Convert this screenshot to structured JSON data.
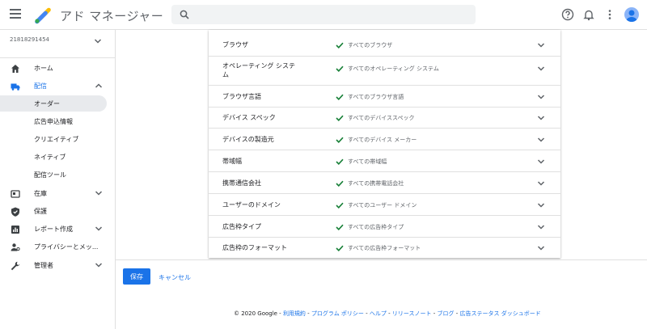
{
  "header": {
    "app_title": "アド マネージャー",
    "search_placeholder": ""
  },
  "sidebar": {
    "account": "21818291454",
    "items": [
      {
        "label": "ホーム",
        "icon": "home-icon"
      },
      {
        "label": "配信",
        "icon": "truck-icon",
        "active": true,
        "expanded": true
      },
      {
        "label": "在庫",
        "icon": "inventory-icon"
      },
      {
        "label": "保護",
        "icon": "shield-icon"
      },
      {
        "label": "レポート作成",
        "icon": "bar-chart-icon"
      },
      {
        "label": "プライバシーとメッ...",
        "icon": "privacy-icon"
      },
      {
        "label": "管理者",
        "icon": "wrench-icon"
      }
    ],
    "delivery_subitems": [
      "オーダー",
      "広告申込情報",
      "クリエイティブ",
      "ネイティブ",
      "配信ツール"
    ]
  },
  "targeting": [
    {
      "label": "ブラウザ",
      "value": "すべてのブラウザ"
    },
    {
      "label": "オペレーティング システム",
      "value": "すべてのオペレーティング システム"
    },
    {
      "label": "ブラウザ言語",
      "value": "すべてのブラウザ言語"
    },
    {
      "label": "デバイス スペック",
      "value": "すべてのデバイススペック"
    },
    {
      "label": "デバイスの製造元",
      "value": "すべてのデバイス メーカー"
    },
    {
      "label": "帯域幅",
      "value": "すべての帯域幅"
    },
    {
      "label": "携帯通信会社",
      "value": "すべての携帯電話会社"
    },
    {
      "label": "ユーザーのドメイン",
      "value": "すべてのユーザー ドメイン"
    },
    {
      "label": "広告枠タイプ",
      "value": "すべての広告枠タイプ"
    },
    {
      "label": "広告枠のフォーマット",
      "value": "すべての広告枠フォーマット"
    }
  ],
  "actions": {
    "save": "保存",
    "cancel": "キャンセル"
  },
  "footer": {
    "copyright": "© 2020 Google - ",
    "links": [
      "利用規約",
      "プログラム ポリシー",
      "ヘルプ",
      "リリースノート",
      "ブログ",
      "広告ステータス ダッシュボード"
    ],
    "separator": " - "
  },
  "colors": {
    "accent": "#1a73e8",
    "check": "#188038"
  }
}
